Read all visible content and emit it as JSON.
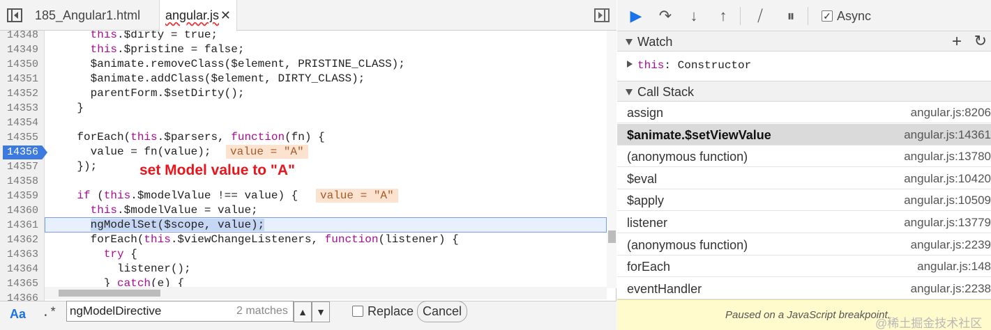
{
  "tabs": [
    {
      "label": "185_Angular1.html",
      "active": false
    },
    {
      "label": "angular.js",
      "active": true,
      "close_glyph": "✕"
    }
  ],
  "code": {
    "lines": [
      {
        "n": "14348",
        "t": "      this.$dirty = true;",
        "kw": [
          "this"
        ]
      },
      {
        "n": "14349",
        "t": "      this.$pristine = false;"
      },
      {
        "n": "14350",
        "t": "      $animate.removeClass($element, PRISTINE_CLASS);"
      },
      {
        "n": "14351",
        "t": "      $animate.addClass($element, DIRTY_CLASS);"
      },
      {
        "n": "14352",
        "t": "      parentForm.$setDirty();"
      },
      {
        "n": "14353",
        "t": "    }"
      },
      {
        "n": "14354",
        "t": ""
      },
      {
        "n": "14355",
        "t": "    forEach(this.$parsers, function(fn) {"
      },
      {
        "n": "14356",
        "t": "      value = fn(value);"
      },
      {
        "n": "14357",
        "t": "    });"
      },
      {
        "n": "14358",
        "t": ""
      },
      {
        "n": "14359",
        "t": "    if (this.$modelValue !== value) {"
      },
      {
        "n": "14360",
        "t": "      this.$modelValue = value;"
      },
      {
        "n": "14361",
        "t": "      ngModelSet($scope, value);"
      },
      {
        "n": "14362",
        "t": "      forEach(this.$viewChangeListeners, function(listener) {"
      },
      {
        "n": "14363",
        "t": "        try {"
      },
      {
        "n": "14364",
        "t": "          listener();"
      },
      {
        "n": "14365",
        "t": "        } catch(e) {"
      },
      {
        "n": "14366",
        "t": ""
      }
    ],
    "breakpoint_line": "14356",
    "inline_values": [
      "value = \"A\"",
      "value = \"A\""
    ],
    "annotation": "set Model value to \"A\""
  },
  "search": {
    "case_label": "Aa",
    "regex_label": ".*",
    "query": "ngModelDirective",
    "matches": "2 matches",
    "replace_label": "Replace",
    "cancel_label": "Cancel"
  },
  "debugger": {
    "async_label": "Async",
    "watch": {
      "title": "Watch",
      "items": [
        {
          "name": "this",
          "value": "Constructor"
        }
      ]
    },
    "call_stack": {
      "title": "Call Stack",
      "frames": [
        {
          "fn": "assign",
          "loc": "angular.js:8206"
        },
        {
          "fn": "$animate.$setViewValue",
          "loc": "angular.js:14361",
          "active": true
        },
        {
          "fn": "(anonymous function)",
          "loc": "angular.js:13780"
        },
        {
          "fn": "$eval",
          "loc": "angular.js:10420"
        },
        {
          "fn": "$apply",
          "loc": "angular.js:10509"
        },
        {
          "fn": "listener",
          "loc": "angular.js:13779"
        },
        {
          "fn": "(anonymous function)",
          "loc": "angular.js:2239"
        },
        {
          "fn": "forEach",
          "loc": "angular.js:148"
        },
        {
          "fn": "eventHandler",
          "loc": "angular.js:2238"
        }
      ]
    },
    "paused_text": "Paused on a JavaScript breakpoint.",
    "watermark": "@稀土掘金技术社区"
  },
  "icons": [
    "navigator-toggle-icon",
    "show-debugger-icon",
    "resume-icon",
    "step-over-icon",
    "step-into-icon",
    "step-out-icon",
    "deactivate-breakpoints-icon",
    "pause-on-exceptions-icon",
    "add-watch-icon",
    "refresh-watch-icon"
  ],
  "colors": {
    "keyword": "#aa0d91",
    "breakpoint": "#3d7ae0",
    "annotation": "#e8161c",
    "accent": "#1a73e8"
  }
}
